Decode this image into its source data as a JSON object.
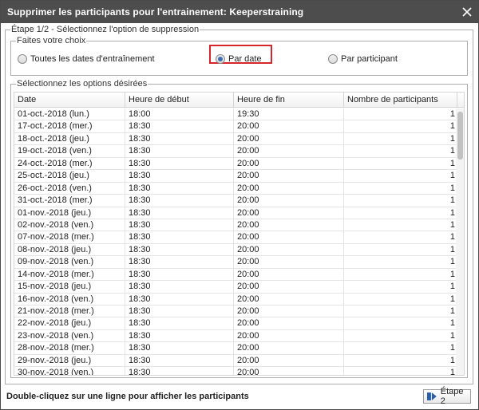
{
  "window": {
    "title": "Supprimer les participants pour l'entrainement: Keeperstraining",
    "close_label": "close"
  },
  "step": {
    "legend": "Étape 1/2 - Sélectionnez l'option de suppression"
  },
  "choice": {
    "legend": "Faites votre choix",
    "options": [
      {
        "label": "Toutes les dates d'entraînement",
        "selected": false
      },
      {
        "label": "Par date",
        "selected": true
      },
      {
        "label": "Par participant",
        "selected": false
      }
    ],
    "highlight_color": "#d6262b"
  },
  "options_panel": {
    "legend": "Sélectionnez les options désirées",
    "columns": [
      "Date",
      "Heure de début",
      "Heure de fin",
      "Nombre de participants"
    ],
    "rows": [
      [
        "01-oct.-2018 (lun.)",
        "18:00",
        "19:30",
        "1"
      ],
      [
        "17-oct.-2018 (mer.)",
        "18:30",
        "20:00",
        "1"
      ],
      [
        "18-oct.-2018 (jeu.)",
        "18:30",
        "20:00",
        "1"
      ],
      [
        "19-oct.-2018 (ven.)",
        "18:30",
        "20:00",
        "1"
      ],
      [
        "24-oct.-2018 (mer.)",
        "18:30",
        "20:00",
        "1"
      ],
      [
        "25-oct.-2018 (jeu.)",
        "18:30",
        "20:00",
        "1"
      ],
      [
        "26-oct.-2018 (ven.)",
        "18:30",
        "20:00",
        "1"
      ],
      [
        "31-oct.-2018 (mer.)",
        "18:30",
        "20:00",
        "1"
      ],
      [
        "01-nov.-2018 (jeu.)",
        "18:30",
        "20:00",
        "1"
      ],
      [
        "02-nov.-2018 (ven.)",
        "18:30",
        "20:00",
        "1"
      ],
      [
        "07-nov.-2018 (mer.)",
        "18:30",
        "20:00",
        "1"
      ],
      [
        "08-nov.-2018 (jeu.)",
        "18:30",
        "20:00",
        "1"
      ],
      [
        "09-nov.-2018 (ven.)",
        "18:30",
        "20:00",
        "1"
      ],
      [
        "14-nov.-2018 (mer.)",
        "18:30",
        "20:00",
        "1"
      ],
      [
        "15-nov.-2018 (jeu.)",
        "18:30",
        "20:00",
        "1"
      ],
      [
        "16-nov.-2018 (ven.)",
        "18:30",
        "20:00",
        "1"
      ],
      [
        "21-nov.-2018 (mer.)",
        "18:30",
        "20:00",
        "1"
      ],
      [
        "22-nov.-2018 (jeu.)",
        "18:30",
        "20:00",
        "1"
      ],
      [
        "23-nov.-2018 (ven.)",
        "18:30",
        "20:00",
        "1"
      ],
      [
        "28-nov.-2018 (mer.)",
        "18:30",
        "20:00",
        "1"
      ],
      [
        "29-nov.-2018 (jeu.)",
        "18:30",
        "20:00",
        "1"
      ],
      [
        "30-nov.-2018 (ven.)",
        "18:30",
        "20:00",
        "1"
      ]
    ]
  },
  "footer": {
    "hint": "Double-cliquez sur une ligne pour afficher les participants",
    "next_label": "Étape 2",
    "next_icon": "next-step-icon"
  }
}
